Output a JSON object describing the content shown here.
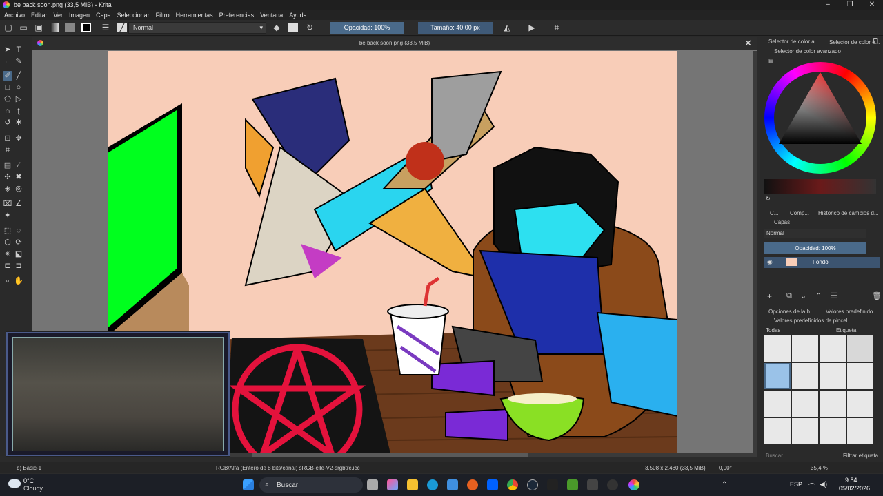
{
  "window": {
    "title": "be back soon.png (33,5 MiB) - Krita",
    "controls": [
      "–",
      "❐",
      "✕"
    ]
  },
  "menu": [
    "Archivo",
    "Editar",
    "Ver",
    "Imagen",
    "Capa",
    "Seleccionar",
    "Filtro",
    "Herramientas",
    "Preferencias",
    "Ventana",
    "Ayuda"
  ],
  "toolbar": {
    "blend_mode": "Normal",
    "opacity": "Opacidad: 100%",
    "size": "Tamaño: 40,00 px"
  },
  "document": {
    "tab_title": "be back soon.png (33,5 MiB)",
    "close": "✕"
  },
  "dock": {
    "top_tabs": [
      "Selector de color a...",
      "Selector de color e..."
    ],
    "color_panel_title": "Selector de color avanzado",
    "mid_tabs": [
      "C...",
      "Comp...",
      "Histórico de cambios d..."
    ],
    "layers_title": "Capas",
    "layer_blend": "Normal",
    "layer_opacity": "Opacidad:  100%",
    "layer_name": "Fondo",
    "preset_tabs": [
      "Opciones de la h...",
      "Valores predefinido..."
    ],
    "presets_title": "Valores predefinidos de pincel",
    "preset_filter": "Todas",
    "preset_tag": "Etiqueta",
    "search_placeholder": "Buscar",
    "filter_tag": "Filtrar etiqueta"
  },
  "status": {
    "brush": "b) Basic-1",
    "color_space": "RGB/Alfa (Entero de 8 bits/canal)  sRGB-elle-V2-srgbtrc.icc",
    "dimensions": "3.508 x 2.480 (33,5 MiB)",
    "rotation": "0,00°",
    "zoom": "35,4 %"
  },
  "taskbar": {
    "weather_temp": "0°C",
    "weather_desc": "Cloudy",
    "search": "Buscar",
    "language": "ESP",
    "time": "9:54",
    "date": "05/02/2026"
  },
  "colors": {
    "accent": "#4a6a8a",
    "canvas_bg": "#f8cdb8",
    "tv_screen": "#00ff1e"
  }
}
